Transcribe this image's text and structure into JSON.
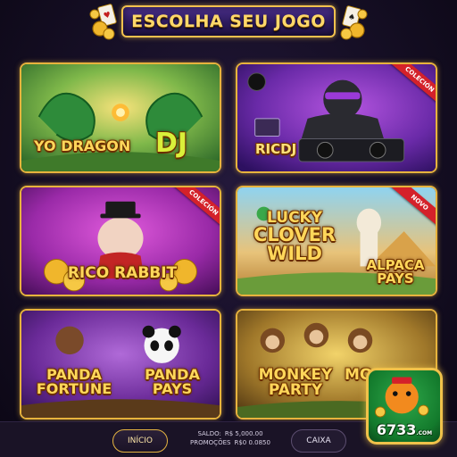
{
  "header": {
    "title": "ESCOLHA SEU JOGO"
  },
  "games": [
    {
      "title_lines": [
        "YO DRAGON"
      ],
      "title_suffix": "DJ",
      "badge": ""
    },
    {
      "title_lines": [
        "RICDJ"
      ],
      "title_suffix": "",
      "badge": "COLECIÓN"
    },
    {
      "title_lines": [
        "RICO RABBIT"
      ],
      "title_suffix": "",
      "badge": "COLECIÓN"
    },
    {
      "title_lines": [
        "LUCKY",
        "CLOVER",
        "WILD"
      ],
      "title_suffix": "ALPACA PAYS",
      "badge": "NOVO"
    },
    {
      "title_lines": [
        "PANDA",
        "FORTUNE"
      ],
      "title_suffix": "PANDA PAYS",
      "badge": ""
    },
    {
      "title_lines": [
        "MONKEY",
        "PARTY"
      ],
      "title_suffix": "MO",
      "badge": ""
    }
  ],
  "bottom_bar": {
    "inicio_label": "INÍCIO",
    "saldo_label": "SALDO:",
    "saldo_value": "R$ 5,000.00",
    "promocoes_label": "PROMOÇÕES",
    "promocoes_value": "R$0 0.0850",
    "caixa_label": "CAIXA"
  },
  "app_icon": {
    "label": "6733",
    "suffix": ".COM"
  },
  "colors": {
    "accent_gold": "#f2c14e",
    "background": "#120c1f",
    "badge_red": "#d4212a"
  }
}
